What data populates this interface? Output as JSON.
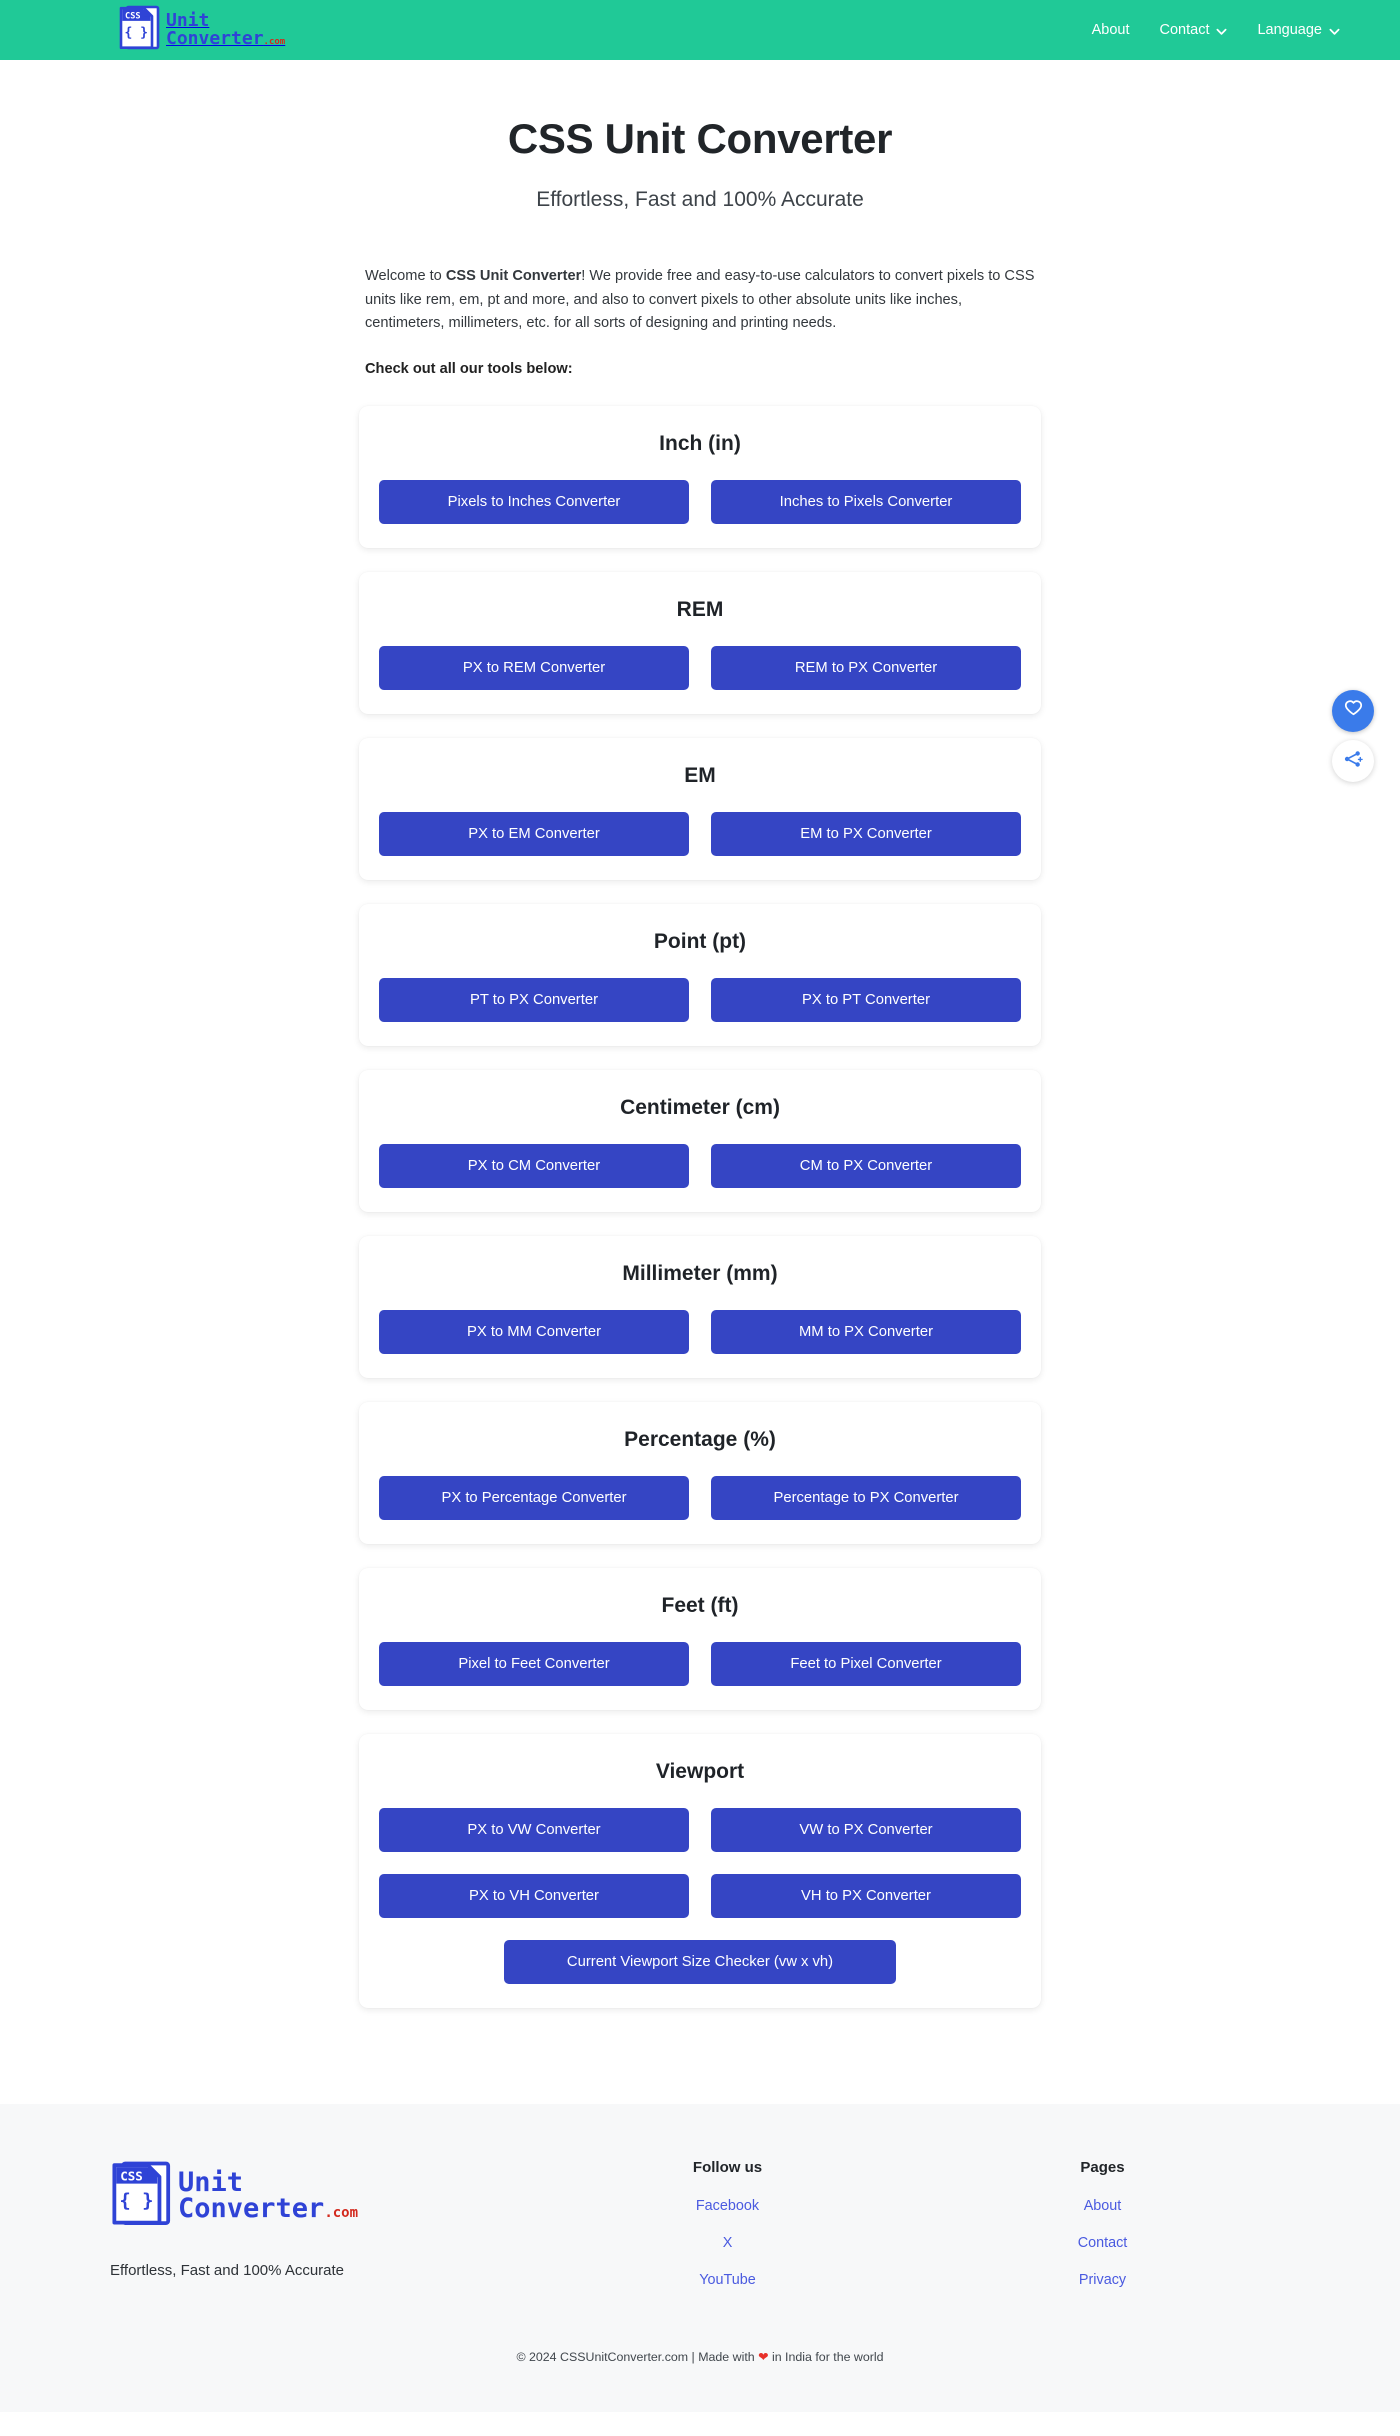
{
  "brand": {
    "icon_label": "CSS",
    "icon_braces": "{ }",
    "line1": "Unit",
    "line2": "Converter",
    "suffix": ".com"
  },
  "nav": {
    "items": [
      {
        "label": "About",
        "has_caret": false
      },
      {
        "label": "Contact",
        "has_caret": true
      },
      {
        "label": "Language",
        "has_caret": true
      }
    ]
  },
  "hero": {
    "title": "CSS Unit Converter",
    "subtitle": "Effortless, Fast and 100% Accurate"
  },
  "intro": {
    "p_before": "Welcome to ",
    "p_bold": "CSS Unit Converter",
    "p_after": "! We provide free and easy-to-use calculators to convert pixels to CSS units like rem, em, pt and more, and also to convert pixels to other absolute units like inches, centimeters, millimeters, etc. for all sorts of designing and printing needs.",
    "tools_line": "Check out all our tools below:"
  },
  "cards": [
    {
      "title": "Inch (in)",
      "buttons": [
        "Pixels to Inches Converter",
        "Inches to Pixels Converter"
      ]
    },
    {
      "title": "REM",
      "buttons": [
        "PX to REM Converter",
        "REM to PX Converter"
      ]
    },
    {
      "title": "EM",
      "buttons": [
        "PX to EM Converter",
        "EM to PX Converter"
      ]
    },
    {
      "title": "Point (pt)",
      "buttons": [
        "PT to PX Converter",
        "PX to PT Converter"
      ]
    },
    {
      "title": "Centimeter (cm)",
      "buttons": [
        "PX to CM Converter",
        "CM to PX Converter"
      ]
    },
    {
      "title": "Millimeter (mm)",
      "buttons": [
        "PX to MM Converter",
        "MM to PX Converter"
      ]
    },
    {
      "title": "Percentage (%)",
      "buttons": [
        "PX to Percentage Converter",
        "Percentage to PX Converter"
      ]
    },
    {
      "title": "Feet (ft)",
      "buttons": [
        "Pixel to Feet Converter",
        "Feet to Pixel Converter"
      ]
    },
    {
      "title": "Viewport",
      "buttons": [
        "PX to VW Converter",
        "VW to PX Converter",
        "PX to VH Converter",
        "VH to PX Converter"
      ],
      "wide_button": "Current Viewport Size Checker (vw x vh)"
    }
  ],
  "floaters": {
    "like_icon": "heart-icon",
    "share_icon": "share-icon"
  },
  "footer": {
    "tagline": "Effortless, Fast and 100% Accurate",
    "columns": [
      {
        "heading": "Follow us",
        "links": [
          "Facebook",
          "X",
          "YouTube"
        ]
      },
      {
        "heading": "Pages",
        "links": [
          "About",
          "Contact",
          "Privacy"
        ]
      }
    ],
    "copyright_before": "© 2024 CSSUnitConverter.com | Made with ",
    "copyright_heart": "❤",
    "copyright_after": " in India for the world"
  },
  "colors": {
    "header_teal": "#20c997",
    "button_blue": "#3545c4",
    "link_blue": "#4a5ae0",
    "logo_blue": "#2f43d6",
    "logo_red": "#d32a1e",
    "footer_bg": "#f7f8f9",
    "heart_red": "#e8302a"
  }
}
